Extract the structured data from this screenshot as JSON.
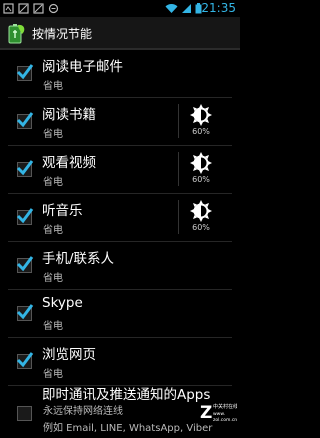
{
  "status_bar": {
    "time": "21:35",
    "icons": [
      "notification-icon",
      "notification-icon",
      "notification-icon",
      "notification-icon",
      "wifi-icon",
      "signal-icon",
      "battery-icon"
    ]
  },
  "app_bar": {
    "title": "按情况节能",
    "icon": "battery-leaf-icon"
  },
  "items": [
    {
      "label": "阅读电子邮件",
      "sub": "省电",
      "checked": true,
      "brightness": false
    },
    {
      "label": "阅读书籍",
      "sub": "省电",
      "checked": true,
      "brightness": true,
      "percent": "60%"
    },
    {
      "label": "观看视频",
      "sub": "省电",
      "checked": true,
      "brightness": true,
      "percent": "60%"
    },
    {
      "label": "听音乐",
      "sub": "省电",
      "checked": true,
      "brightness": true,
      "percent": "60%"
    },
    {
      "label": "手机/联系人",
      "sub": "省电",
      "checked": true,
      "brightness": false
    },
    {
      "label": "Skype",
      "sub": "省电",
      "checked": true,
      "brightness": false
    },
    {
      "label": "浏览网页",
      "sub": "省电",
      "checked": true,
      "brightness": false
    },
    {
      "label": "即时通讯及推送通知的Apps",
      "sub": "永远保持网络连线",
      "sub2": "例如 Email, LINE, WhatsApp, Viber",
      "checked": false,
      "brightness": false
    }
  ],
  "colors": {
    "accent": "#33b5e5",
    "check": "#33b5e5",
    "background": "#000000"
  },
  "watermark": {
    "brand": "ZOL",
    "text": "中关村在线",
    "url": "www.zol.com.cn"
  }
}
